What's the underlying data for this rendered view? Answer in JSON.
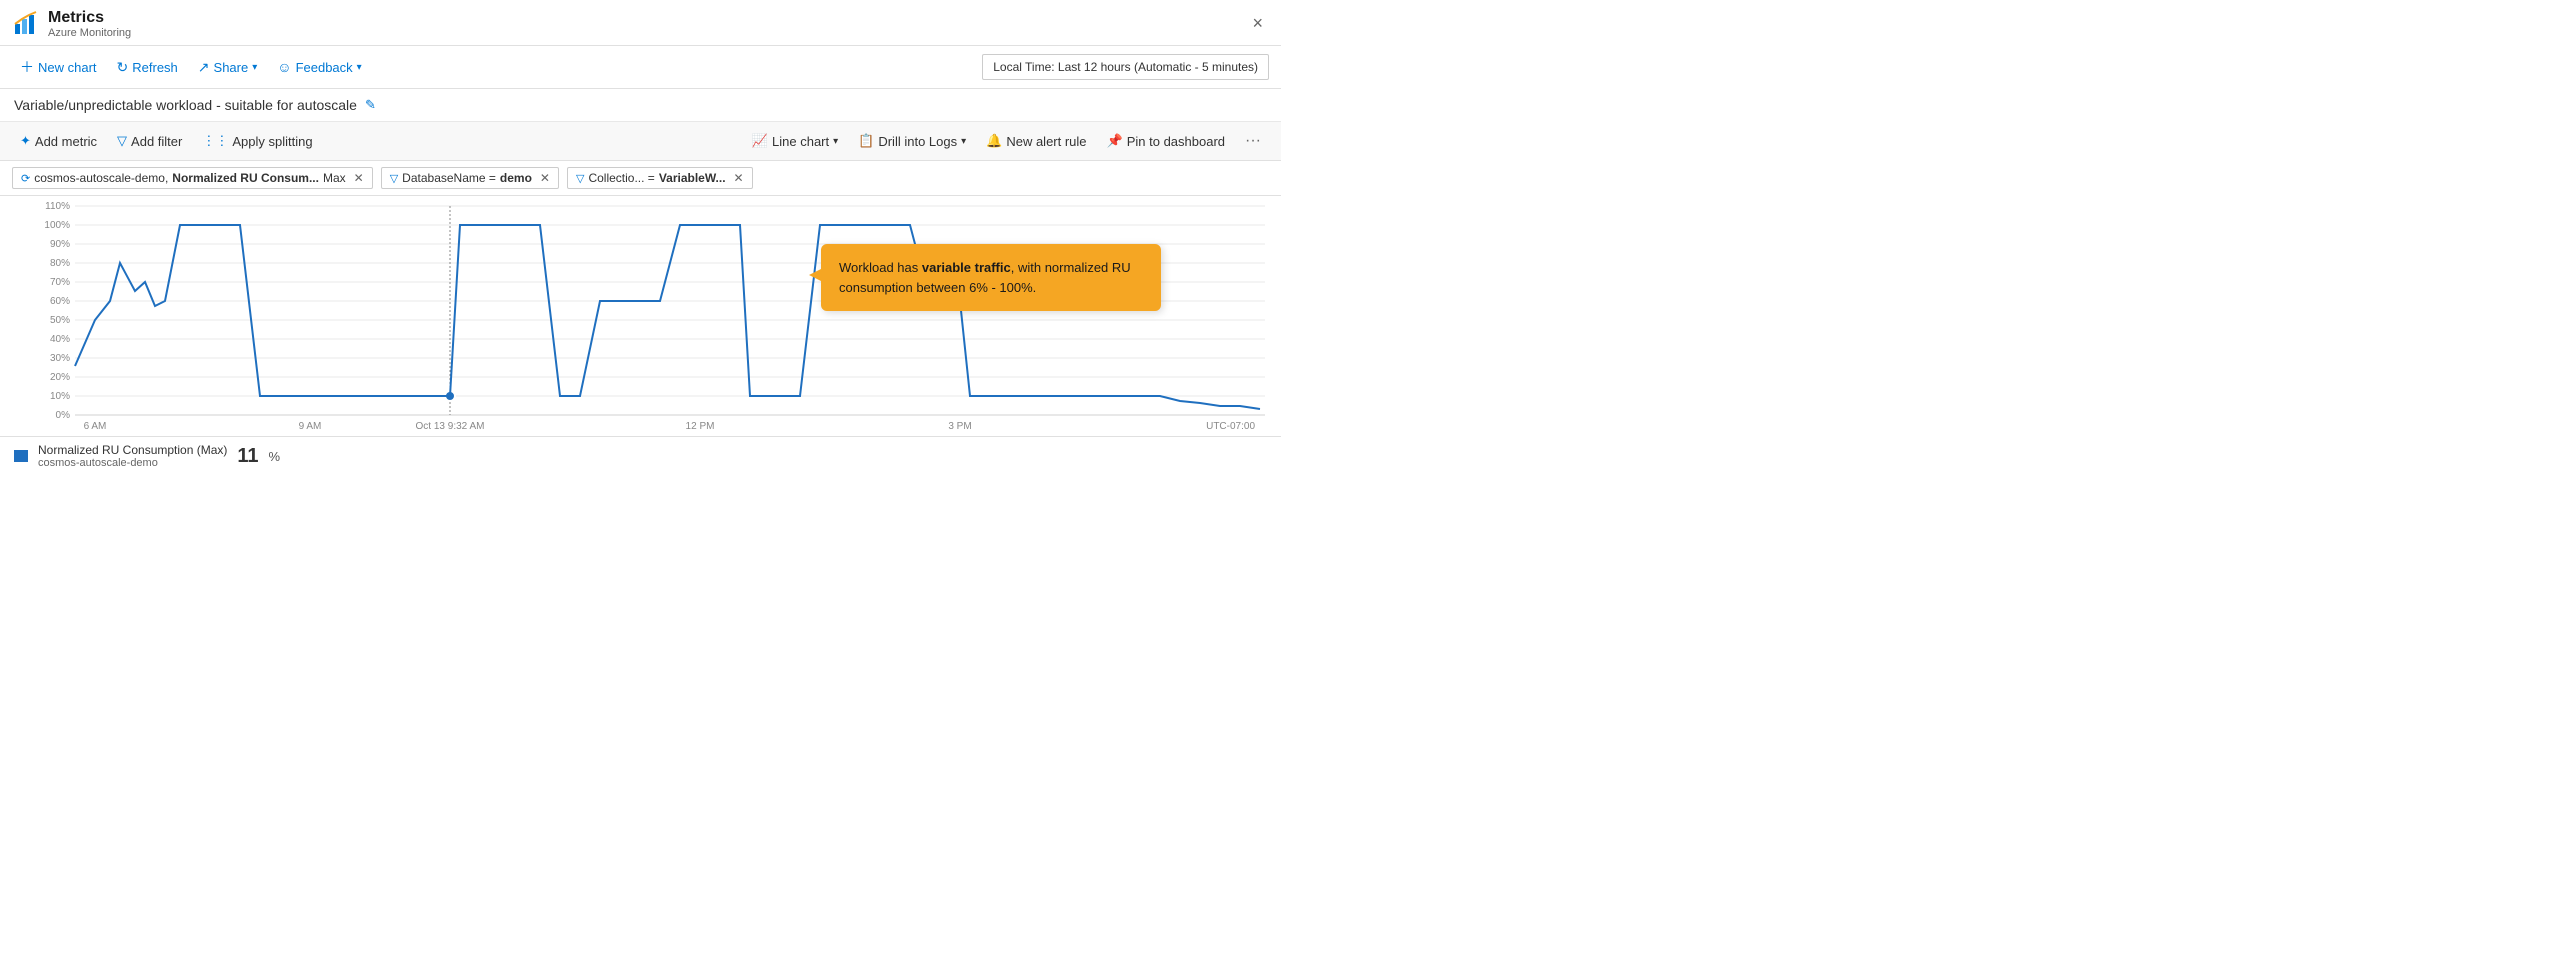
{
  "app": {
    "title": "Metrics",
    "subtitle": "Azure Monitoring",
    "close_label": "×"
  },
  "toolbar": {
    "new_chart": "New chart",
    "refresh": "Refresh",
    "share": "Share",
    "feedback": "Feedback",
    "time_range": "Local Time: Last 12 hours (Automatic - 5 minutes)"
  },
  "chart_title": "Variable/unpredictable workload - suitable for autoscale",
  "metrics_toolbar": {
    "add_metric": "Add metric",
    "add_filter": "Add filter",
    "apply_splitting": "Apply splitting",
    "line_chart": "Line chart",
    "drill_into_logs": "Drill into Logs",
    "new_alert_rule": "New alert rule",
    "pin_to_dashboard": "Pin to dashboard"
  },
  "filters": [
    {
      "id": "metric",
      "icon": "⟳",
      "text_normal": "cosmos-autoscale-demo, ",
      "text_bold": "Normalized RU Consum...",
      "text_suffix": " Max",
      "removable": true
    },
    {
      "id": "database",
      "icon": "▽",
      "text_normal": "DatabaseName = ",
      "text_bold": "demo",
      "removable": true
    },
    {
      "id": "collection",
      "icon": "▽",
      "text_normal": "Collectio... = ",
      "text_bold": "VariableW...",
      "removable": true
    }
  ],
  "chart": {
    "y_labels": [
      "110%",
      "100%",
      "90%",
      "80%",
      "70%",
      "60%",
      "50%",
      "40%",
      "30%",
      "20%",
      "10%",
      "0%"
    ],
    "x_labels": [
      "6 AM",
      "9 AM",
      "Oct 13 9:32 AM",
      "12 PM",
      "3 PM",
      "UTC-07:00"
    ],
    "crosshair_label": "Oct 13 9:32 AM",
    "tooltip": {
      "text_normal": "Workload has ",
      "text_bold": "variable traffic",
      "text_normal2": ", with normalized RU consumption between 6% - 100%."
    }
  },
  "legend": {
    "label": "Normalized RU Consumption (Max)",
    "sublabel": "cosmos-autoscale-demo",
    "value": "11",
    "unit": "%"
  }
}
